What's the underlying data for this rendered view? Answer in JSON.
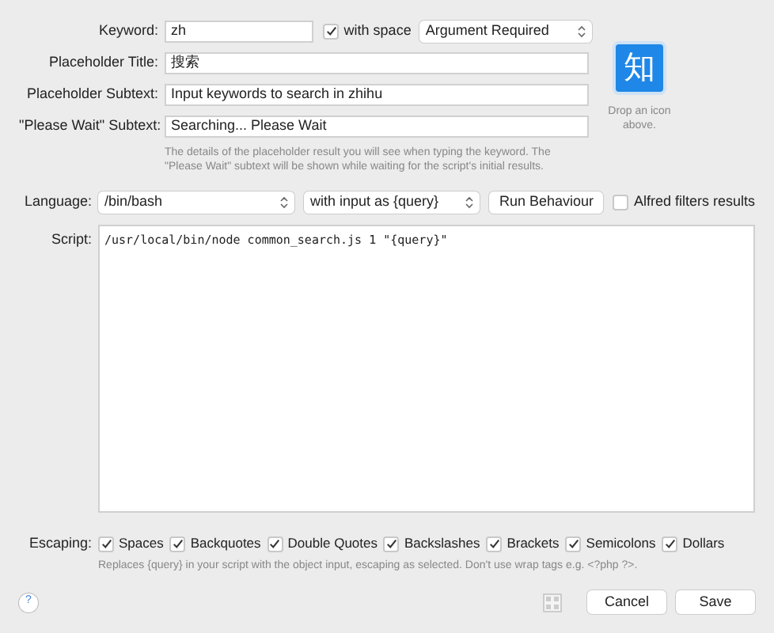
{
  "fields": [
    {
      "kind": "keyword",
      "label": "Keyword:",
      "value": "zh",
      "with_space": {
        "label": "with space",
        "checked": true
      },
      "mode": "Argument Required"
    },
    {
      "kind": "text",
      "label": "Placeholder Title:",
      "value": "搜索"
    },
    {
      "kind": "text",
      "label": "Placeholder Subtext:",
      "value": "Input keywords to search in zhihu"
    },
    {
      "kind": "text",
      "label": "\"Please Wait\" Subtext:",
      "value": "Searching... Please Wait"
    }
  ],
  "placeholder_help": "The details of the placeholder result you will see when typing the keyword. The \"Please Wait\" subtext will be shown while waiting for the script's initial results.",
  "icon": {
    "glyph": "知",
    "caption": "Drop an icon above."
  },
  "language": {
    "label": "Language:",
    "value": "/bin/bash",
    "input_mode": "with input as {query}",
    "run_behaviour": "Run Behaviour",
    "alfred_filters": {
      "label": "Alfred filters results",
      "checked": false
    }
  },
  "script": {
    "label": "Script:",
    "value": "/usr/local/bin/node common_search.js 1 \"{query}\""
  },
  "escaping": {
    "label": "Escaping:",
    "options": [
      {
        "label": "Spaces",
        "checked": true
      },
      {
        "label": "Backquotes",
        "checked": true
      },
      {
        "label": "Double Quotes",
        "checked": true
      },
      {
        "label": "Backslashes",
        "checked": true
      },
      {
        "label": "Brackets",
        "checked": true
      },
      {
        "label": "Semicolons",
        "checked": true
      },
      {
        "label": "Dollars",
        "checked": true
      }
    ],
    "help": "Replaces {query} in your script with the object input, escaping as selected. Don't use wrap tags e.g. <?php ?>."
  },
  "footer": {
    "help": "?",
    "buttons": [
      "Cancel",
      "Save"
    ]
  }
}
